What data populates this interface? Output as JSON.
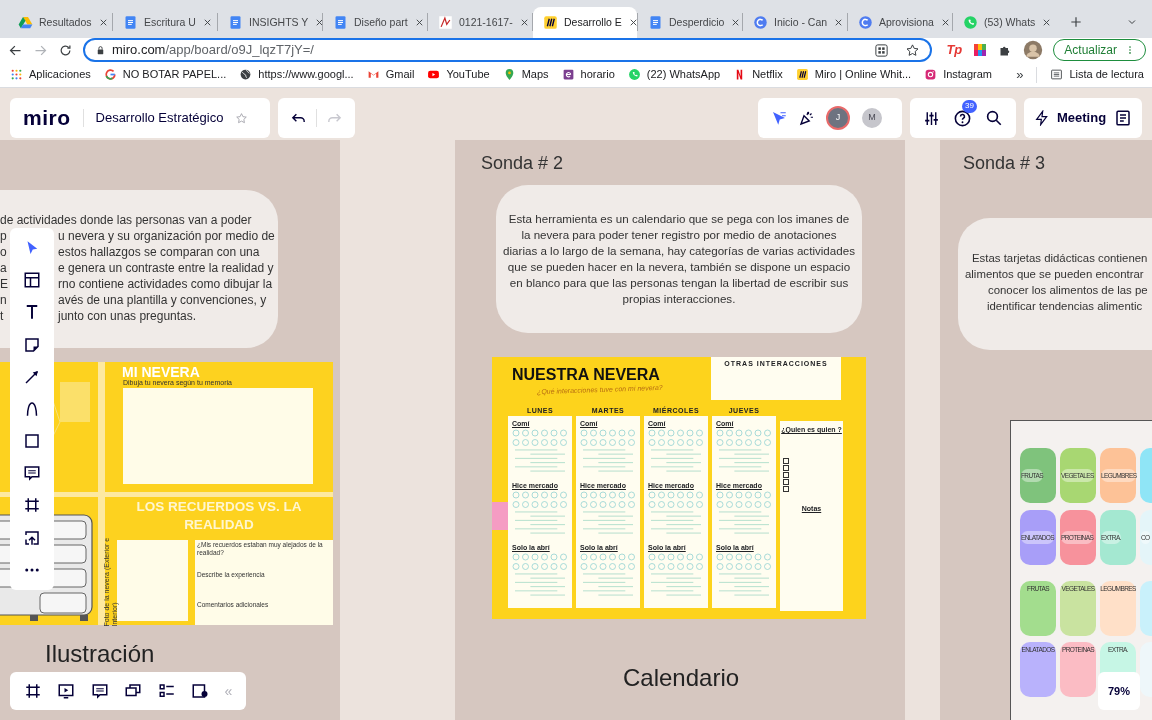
{
  "browser": {
    "tabs": [
      {
        "title": "Resultados",
        "kind": "drive",
        "selected": false
      },
      {
        "title": "Escritura U",
        "kind": "docs",
        "selected": false
      },
      {
        "title": "INSIGHTS Y",
        "kind": "docs",
        "selected": false
      },
      {
        "title": "Diseño part",
        "kind": "docs",
        "selected": false
      },
      {
        "title": "0121-1617-",
        "kind": "pdf",
        "selected": false
      },
      {
        "title": "Desarrollo E",
        "kind": "miro",
        "selected": true
      },
      {
        "title": "Desperdicio",
        "kind": "docs",
        "selected": false
      },
      {
        "title": "Inicio - Can",
        "kind": "canva",
        "selected": false
      },
      {
        "title": "Aprovisiona",
        "kind": "canva",
        "selected": false
      },
      {
        "title": "(53) Whats",
        "kind": "whatsapp",
        "selected": false
      }
    ],
    "url_host": "miro.com",
    "url_path": "/app/board/o9J_lqzT7jY=/",
    "extension_label": "Tp",
    "update_button": "Actualizar",
    "bookmarks": [
      {
        "label": "Aplicaciones",
        "kind": "apps"
      },
      {
        "label": "NO BOTAR PAPEL...",
        "kind": "google"
      },
      {
        "label": "https://www.googl...",
        "kind": "globe"
      },
      {
        "label": "Gmail",
        "kind": "gmail"
      },
      {
        "label": "YouTube",
        "kind": "youtube"
      },
      {
        "label": "Maps",
        "kind": "maps"
      },
      {
        "label": "horario",
        "kind": "square"
      },
      {
        "label": "(22) WhatsApp",
        "kind": "whatsapp"
      },
      {
        "label": "Netflix",
        "kind": "netflix"
      },
      {
        "label": "Miro | Online Whit...",
        "kind": "miro"
      },
      {
        "label": "Instagram",
        "kind": "instagram"
      }
    ],
    "bookmarks_more": "»",
    "reading_list": "Lista de lectura"
  },
  "board": {
    "logo": "miro",
    "title": "Desarrollo Estratégico",
    "avatars": [
      {
        "initial": "J",
        "color": "#6d7380",
        "highlighted": true
      },
      {
        "initial": "M",
        "color": "#c6c6cc",
        "highlighted": false
      }
    ],
    "help_badge": "39",
    "meeting_button": "Meeting",
    "zoom": "79%",
    "collapse": "«"
  },
  "tools": [
    {
      "kind": "cursor",
      "selected": true
    },
    {
      "kind": "templates",
      "selected": false
    },
    {
      "kind": "text",
      "selected": false
    },
    {
      "kind": "sticky",
      "selected": false
    },
    {
      "kind": "arrow",
      "selected": false
    },
    {
      "kind": "pen",
      "selected": false
    },
    {
      "kind": "shape",
      "selected": false
    },
    {
      "kind": "comment",
      "selected": false
    },
    {
      "kind": "frame",
      "selected": false
    },
    {
      "kind": "upload",
      "selected": false
    },
    {
      "kind": "more",
      "selected": false
    }
  ],
  "bottom_tools": [
    {
      "kind": "frame"
    },
    {
      "kind": "play"
    },
    {
      "kind": "comment"
    },
    {
      "kind": "cards"
    },
    {
      "kind": "list"
    },
    {
      "kind": "add"
    }
  ],
  "sonda_1": {
    "card_first_line": "de actividades donde las personas van a poder",
    "card_lines": [
      {
        "left": "p",
        "right": "u nevera y su organización por medio de"
      },
      {
        "left": "o",
        "right": "estos hallazgos se comparan con una"
      },
      {
        "left": "a",
        "right": "e genera un contraste entre la realidad y"
      },
      {
        "left": "E",
        "right": "rno contiene actividades como dibujar la"
      },
      {
        "left": "n",
        "right": "avés de una plantilla y convenciones, y"
      },
      {
        "left": "t",
        "right": "junto con unas preguntas."
      }
    ],
    "mi_nevera": {
      "title": "MI NEVERA",
      "subtitle": "Dibuja tu nevera según tu memoria"
    },
    "recuerdos": {
      "title": "LOS RECUERDOS VS. LA REALIDAD",
      "photo_label": "Foto de la nevera (Exterior e Interior)",
      "prompts": [
        "¿Mis recuerdos estaban muy alejados de la realidad?",
        "Describe la experiencia",
        "Comentarios adicionales"
      ]
    },
    "caption": "Ilustración"
  },
  "sonda_2": {
    "label": "Sonda # 2",
    "card": "Esta herramienta es un calendario que se pega con los imanes de la nevera para poder tener registro por medio de anotaciones diarias a lo largo de la semana, hay categorías de varias actividades que se pueden hacer en la nevera, también se dispone un espacio en blanco para que las personas tengan la libertad de escribir sus propias interacciones.",
    "calendar": {
      "title": "NUESTRA NEVERA",
      "subtitle": "¿Qué interacciones tuve con mi nevera?",
      "other_label": "OTRAS INTERACCIONES",
      "days": [
        {
          "name": "LUNES",
          "sections": [
            "Comí",
            "Hice mercado",
            "Solo la abrí"
          ]
        },
        {
          "name": "MARTES",
          "sections": [
            "Comí",
            "Hice mercado",
            "Solo la abrí"
          ]
        },
        {
          "name": "MIÉRCOLES",
          "sections": [
            "Comí",
            "Hice mercado",
            "Solo la abrí"
          ]
        },
        {
          "name": "JUEVES",
          "sections": [
            "Comí",
            "Hice mercado",
            "Solo la abrí"
          ]
        }
      ],
      "who_title": "¿Quien es quien ?",
      "checkboxes": [
        {
          "checked": false
        },
        {
          "checked": false
        },
        {
          "checked": false
        },
        {
          "checked": false
        },
        {
          "checked": false
        }
      ],
      "notes_label": "Notas"
    },
    "caption": "Calendario"
  },
  "sonda_3": {
    "label": "Sonda # 3",
    "card_lines": [
      "Estas tarjetas didácticas contienen",
      "alimentos que se pueden encontrar",
      "conocer los alimentos de las pe",
      "identificar tendencias alimentic"
    ],
    "food_board": {
      "cards": [
        {
          "label": "FRUTAS",
          "color": "#7fc37c"
        },
        {
          "label": "VEGETALES",
          "color": "#a8d772"
        },
        {
          "label": "LEGUMBRES",
          "color": "#fdc297"
        },
        {
          "color": "#8fe5f6"
        },
        {
          "label": "ENLATADOS",
          "color": "#a89ef8"
        },
        {
          "label": "PROTEINAS",
          "color": "#f7929c"
        },
        {
          "label": "EXTRA.",
          "color": "#a4e8d1"
        },
        {
          "label": "CO",
          "color": "#e4f5f9"
        }
      ],
      "tiles": [
        {
          "label": "FRUTAS",
          "color": "#a3dd8e"
        },
        {
          "label": "VEGETALES",
          "color": "#c9e3a0"
        },
        {
          "label": "LEGUMBRES",
          "color": "#ffe0c8"
        },
        {
          "color": "#c9f1fb"
        },
        {
          "label": "ENLATADOS",
          "color": "#b9b2fc"
        },
        {
          "label": "PROTEINAS",
          "color": "#fbbcc4"
        },
        {
          "label": "EXTRA.",
          "color": "#c6f6e5"
        },
        {
          "color": "#eef7fa"
        }
      ]
    }
  }
}
